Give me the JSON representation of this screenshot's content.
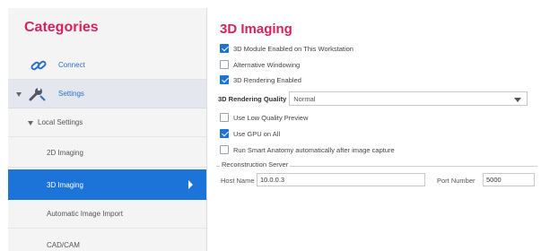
{
  "sidebar": {
    "title": "Categories",
    "items": [
      {
        "label": "Connect"
      },
      {
        "label": "Settings"
      },
      {
        "label": "Local Settings"
      },
      {
        "label": "2D Imaging"
      },
      {
        "label": "3D Imaging"
      },
      {
        "label": "Automatic Image Import"
      },
      {
        "label": "CAD/CAM"
      }
    ]
  },
  "main": {
    "title": "3D Imaging",
    "options": [
      {
        "label": "3D Module Enabled on This Workstation",
        "checked": true
      },
      {
        "label": "Alternative Windowing",
        "checked": false
      },
      {
        "label": "3D Rendering Enabled",
        "checked": true
      }
    ],
    "quality": {
      "label": "3D Rendering Quality",
      "value": "Normal"
    },
    "options2": [
      {
        "label": "Use Low Quality Preview",
        "checked": false
      },
      {
        "label": "Use GPU on All",
        "checked": true
      },
      {
        "label": "Run Smart Anatomy automatically after image capture",
        "checked": false
      }
    ],
    "recon": {
      "title": "Reconstruction Server",
      "host_label": "Host Name",
      "host_value": "10.0.0.3",
      "port_label": "Port Number",
      "port_value": "5000"
    }
  },
  "colors": {
    "accent": "#d4245a",
    "selected": "#1c73d8",
    "link": "#2c6fc9"
  }
}
